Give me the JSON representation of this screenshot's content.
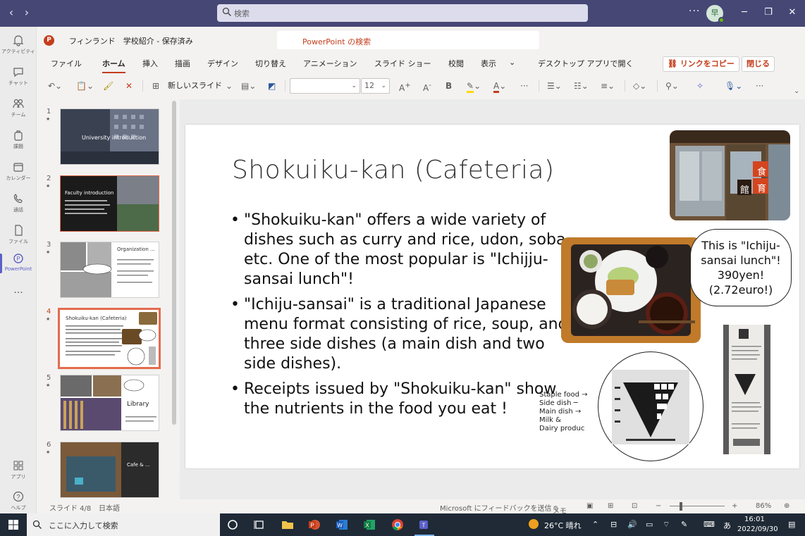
{
  "teams": {
    "search_placeholder": "検索",
    "avatar_initial": "早",
    "app_bar": [
      {
        "id": "activity",
        "label": "アクティビティ"
      },
      {
        "id": "chat",
        "label": "チャット"
      },
      {
        "id": "teams",
        "label": "チーム"
      },
      {
        "id": "assignments",
        "label": "課題"
      },
      {
        "id": "calendar",
        "label": "カレンダー"
      },
      {
        "id": "calls",
        "label": "通話"
      },
      {
        "id": "files",
        "label": "ファイル"
      },
      {
        "id": "powerpoint",
        "label": "PowerPoint"
      }
    ],
    "more_label": "...",
    "apps_label": "アプリ",
    "help_label": "ヘルプ"
  },
  "ppt": {
    "doc_title": "フィンランド　学校紹介 - 保存済み",
    "search_label": "PowerPoint の検索",
    "tabs": [
      "ファイル",
      "ホーム",
      "挿入",
      "描画",
      "デザイン",
      "切り替え",
      "アニメーション",
      "スライド ショー",
      "校閲",
      "表示"
    ],
    "active_tab": "ホーム",
    "open_desktop": "デスクトップ アプリで開く",
    "copy_link": "リンクをコピー",
    "close": "閉じる",
    "new_slide": "新しいスライド",
    "font_size": "12",
    "thumbnails": [
      {
        "num": "1",
        "title": "University introduction"
      },
      {
        "num": "2",
        "title": "Faculty introduction"
      },
      {
        "num": "3",
        "title": "Organization ..."
      },
      {
        "num": "4",
        "title": "Shokuiku-kan (Cafeteria)"
      },
      {
        "num": "5",
        "title": "Library"
      },
      {
        "num": "6",
        "title": "Cafe & ..."
      }
    ],
    "active_slide": "4"
  },
  "slide": {
    "title": "Shokuiku-kan (Cafeteria)",
    "bullets": [
      "\"Shokuiku-kan\" offers a wide variety of dishes such as curry and rice, udon, soba, etc. One of the most popular is \"Ichijju-sansai lunch\"!",
      "\"Ichiju-sansai\" is a traditional Japanese menu format consisting of rice, soup, and three side dishes (a main dish and two side dishes).",
      "Receipts issued by \"Shokuiku-kan\" show the nutrients in the food you eat !"
    ],
    "bubble": [
      "This is \"Ichiju-",
      "sansai lunch\"!",
      "390yen!",
      "(2.72euro!)"
    ],
    "nutri_labels": "Staple food →\nSide dish ─\nMain dish →\nMilk &\nDairy produc",
    "sign_chars": [
      "食",
      "育",
      "館"
    ]
  },
  "status": {
    "slide_of": "スライド 4/8",
    "language": "日本語",
    "feedback": "Microsoft にフィードバックを送信",
    "notes": "メモ",
    "zoom": "86%"
  },
  "taskbar": {
    "search_placeholder": "ここに入力して検索",
    "weather": "26°C 晴れ",
    "ime": "あ",
    "time": "16:01",
    "date": "2022/09/30"
  }
}
